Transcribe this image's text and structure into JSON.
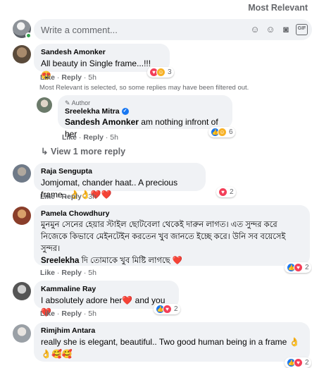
{
  "sort_label": "Most Relevant",
  "composer": {
    "placeholder": "Write a comment...",
    "icons": [
      "sticker-icon",
      "emoji-icon",
      "camera-icon",
      "gif-icon"
    ]
  },
  "comments": [
    {
      "author": "Sandesh Amonker",
      "text": "All beauty in Single frame...!!! 😍",
      "like": "Like",
      "reply": "Reply",
      "time": "5h",
      "reactions": "3"
    },
    {
      "notice": "Most Relevant is selected, so some replies may have been filtered out."
    },
    {
      "badge": "Author",
      "author": "Sreelekha Mitra",
      "mention": "Sandesh Amonker",
      "text": "am nothing infront of her",
      "like": "Like",
      "reply": "Reply",
      "time": "5h",
      "reactions": "6"
    },
    {
      "view_more": "View 1 more reply"
    },
    {
      "author": "Raja Sengupta",
      "text": "Jomjomat, chander haat.. A precious frame ..👌👌❤️❤️",
      "like": "Like",
      "reply": "Reply",
      "time": "3h",
      "reactions": "2"
    },
    {
      "author": "Pamela Chowdhury",
      "text": "মুনমুন সেনের হেয়ার স্টাইল ছোটবেলা থেকেই দারুন লাগত। এত সুন্দর করে নিজেকে কিভাবে মেইনটেইন করতেন খুব জানতে ইচ্ছে করে। উনি সব বয়েসেই সুন্দর।",
      "mention": "Sreelekha",
      "text2": "দি তোমাকে খুব মিষ্টি লাগছে ❤️",
      "like": "Like",
      "reply": "Reply",
      "time": "5h",
      "reactions": "2"
    },
    {
      "author": "Kammaline Ray",
      "text": "I absolutely adore her❤️ and you❤️",
      "like": "Like",
      "reply": "Reply",
      "time": "5h",
      "reactions": "2"
    },
    {
      "author": "Rimjhim Antara",
      "text": "really she is elegant, beautiful.. Two good human being in a frame 👌",
      "text2": "👌🥰🥰",
      "reactions": "2"
    }
  ]
}
